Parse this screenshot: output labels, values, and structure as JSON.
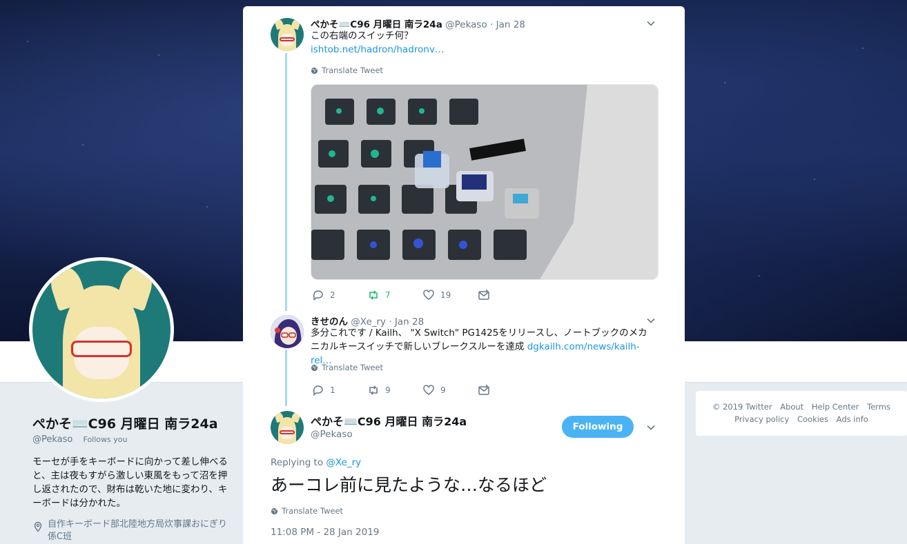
{
  "profile": {
    "name": "ぺかそ⌨️C96 月曜日 南ラ24a",
    "handle": "@Pekaso",
    "follows_you": "Follows you",
    "bio": "モーセが手をキーボードに向かって差し伸べると、主は夜もすがら激しい東風をもって沼を押し返されたので、財布は乾いた地に変わり、キーボードは分かれた。",
    "location": "自作キーボード部北陸地方局炊事課おにぎり係C班"
  },
  "footer": {
    "links": [
      "© 2019 Twitter",
      "About",
      "Help Center",
      "Terms",
      "Privacy policy",
      "Cookies",
      "Ads info"
    ]
  },
  "thread": [
    {
      "name": "ぺかそ⌨️C96 月曜日 南ラ24a",
      "handle": "@Pekaso",
      "date": "· Jan 28",
      "text": "この右端のスイッチ何？",
      "link": "ishtob.net/hadron/hadronv…",
      "translate": "Translate Tweet",
      "replies": "2",
      "retweets": "7",
      "likes": "19"
    },
    {
      "name": "きせのん",
      "handle": "@Xe_ry",
      "date": "· Jan 28",
      "text": "多分これです / Kailh、 \"X Switch\" PG1425をリリースし、ノートブックのメカニカルキースイッチで新しいブレークスルーを達成",
      "link": "dgkailh.com/news/kailh-rel…",
      "translate": "Translate Tweet",
      "replies": "1",
      "retweets": "9",
      "likes": "9"
    }
  ],
  "main_tweet": {
    "name": "ぺかそ⌨️C96 月曜日 南ラ24a",
    "handle": "@Pekaso",
    "follow_label": "Following",
    "replying_prefix": "Replying to",
    "replying_to": "@Xe_ry",
    "text": "あーコレ前に見たような…なるほど",
    "translate": "Translate Tweet",
    "timestamp": "11:08 PM - 28 Jan 2019"
  },
  "colors": {
    "accent": "#1b95e0",
    "follow_button": "#4ab3f4",
    "retweet_active": "#17bf63",
    "thread_line": "#a6d8f3"
  }
}
